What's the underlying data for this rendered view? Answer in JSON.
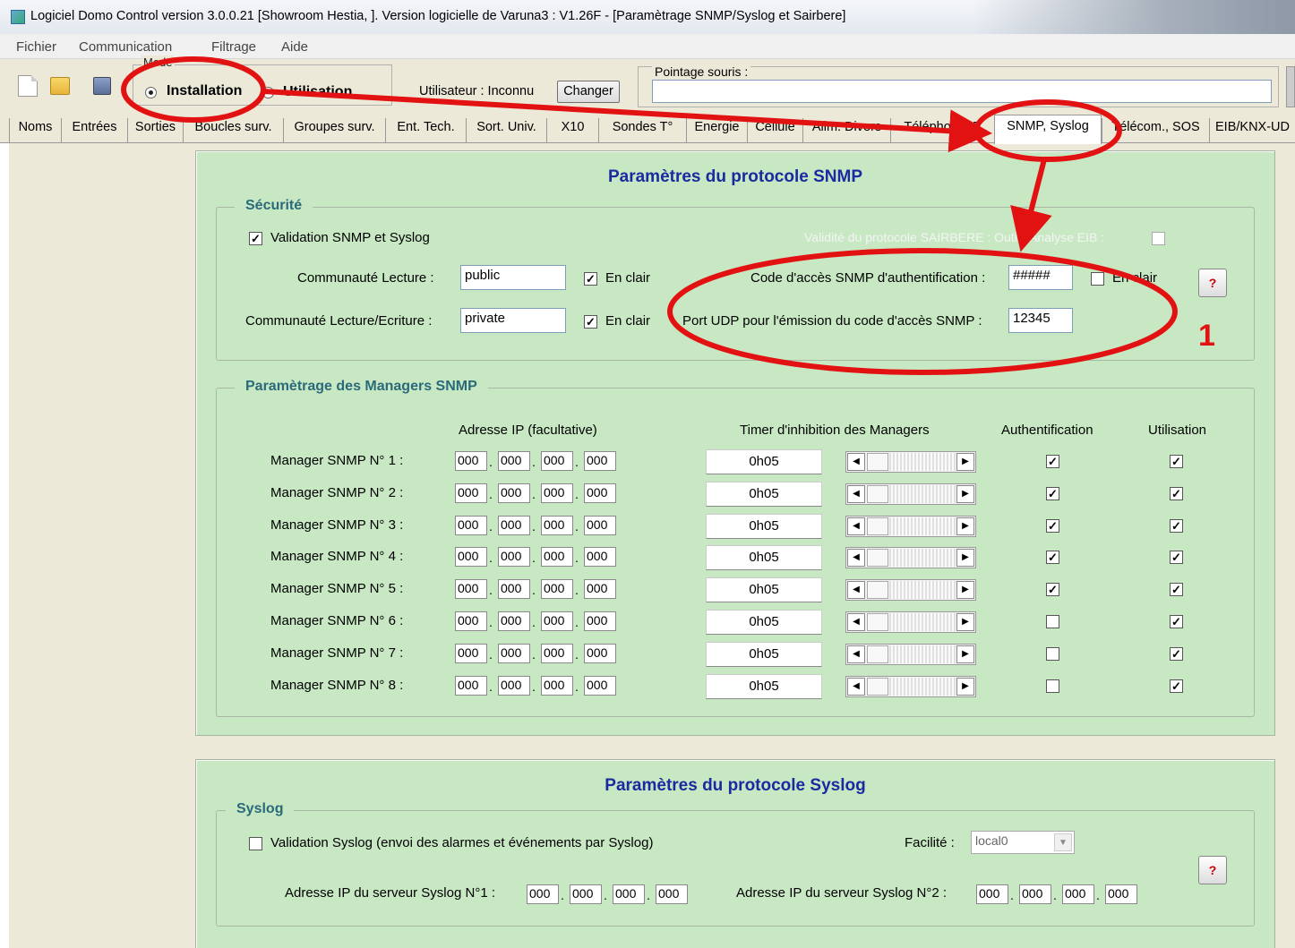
{
  "window": {
    "title": "Logiciel Domo Control version 3.0.0.21 [Showroom Hestia, ].   Version logicielle de Varuna3 : V1.26F - [Paramètrage SNMP/Syslog et Sairbere]"
  },
  "menubar": {
    "items": [
      "Fichier",
      "Communication",
      "Filtrage",
      "Aide"
    ]
  },
  "toolbar": {
    "mode_legend": "Mode",
    "mode_installation": "Installation",
    "mode_utilisation": "Utilisation",
    "selected_mode": "Installation",
    "user_label": "Utilisateur : Inconnu",
    "change_button": "Changer",
    "pointage_label": "Pointage souris :",
    "pointage_value": ""
  },
  "tabs": [
    "Noms",
    "Entrées",
    "Sorties",
    "Boucles surv.",
    "Groupes surv.",
    "Ent. Tech.",
    "Sort. Univ.",
    "X10",
    "Sondes T°",
    "Energie",
    "Cellule",
    "Alim. Divers",
    "Téléphone IP",
    "SNMP, Syslog",
    "Télécom., SOS",
    "EIB/KNX-UD"
  ],
  "active_tab": "SNMP, Syslog",
  "snmp": {
    "title": "Paramètres du protocole SNMP",
    "security": {
      "legend": "Sécurité",
      "validation_label": "Validation SNMP et Syslog",
      "validation_checked": true,
      "sairbere_label": "Validité du protocole SAIRBERE : Outils Analyse EIB :",
      "sairbere_checked": false,
      "read_community_label": "Communauté Lecture :",
      "read_community_value": "public",
      "read_clear_label": "En clair",
      "read_clear_checked": true,
      "rw_community_label": "Communauté Lecture/Ecriture :",
      "rw_community_value": "private",
      "rw_clear_label": "En clair",
      "rw_clear_checked": true,
      "auth_code_label": "Code d'accès SNMP d'authentification :",
      "auth_code_value": "#####",
      "auth_clear_label": "En clair",
      "auth_clear_checked": false,
      "udp_port_label": "Port UDP pour l'émission  du code d'accès SNMP :",
      "udp_port_value": "12345",
      "help": "?"
    },
    "managers": {
      "legend": "Paramètrage des Managers SNMP",
      "col_ip": "Adresse IP (facultative)",
      "col_timer": "Timer d'inhibition des Managers",
      "col_auth": "Authentification",
      "col_use": "Utilisation",
      "rows": [
        {
          "label": "Manager SNMP N° 1 :",
          "ip": [
            "000",
            "000",
            "000",
            "000"
          ],
          "timer": "0h05",
          "auth": true,
          "use": true
        },
        {
          "label": "Manager SNMP N° 2 :",
          "ip": [
            "000",
            "000",
            "000",
            "000"
          ],
          "timer": "0h05",
          "auth": true,
          "use": true
        },
        {
          "label": "Manager SNMP N° 3 :",
          "ip": [
            "000",
            "000",
            "000",
            "000"
          ],
          "timer": "0h05",
          "auth": true,
          "use": true
        },
        {
          "label": "Manager SNMP N° 4 :",
          "ip": [
            "000",
            "000",
            "000",
            "000"
          ],
          "timer": "0h05",
          "auth": true,
          "use": true
        },
        {
          "label": "Manager SNMP N° 5 :",
          "ip": [
            "000",
            "000",
            "000",
            "000"
          ],
          "timer": "0h05",
          "auth": true,
          "use": true
        },
        {
          "label": "Manager SNMP N° 6 :",
          "ip": [
            "000",
            "000",
            "000",
            "000"
          ],
          "timer": "0h05",
          "auth": false,
          "use": true
        },
        {
          "label": "Manager SNMP N° 7 :",
          "ip": [
            "000",
            "000",
            "000",
            "000"
          ],
          "timer": "0h05",
          "auth": false,
          "use": true
        },
        {
          "label": "Manager SNMP N° 8 :",
          "ip": [
            "000",
            "000",
            "000",
            "000"
          ],
          "timer": "0h05",
          "auth": false,
          "use": true
        }
      ]
    }
  },
  "syslog": {
    "title": "Paramètres du protocole Syslog",
    "legend": "Syslog",
    "validation_label": "Validation Syslog (envoi des alarmes et événements par Syslog)",
    "validation_checked": false,
    "facility_label": "Facilité :",
    "facility_value": "local0",
    "server1_label": "Adresse IP du serveur Syslog  N°1 :",
    "server1_ip": [
      "000",
      "000",
      "000",
      "000"
    ],
    "server2_label": "Adresse IP du serveur Syslog  N°2 :",
    "server2_ip": [
      "000",
      "000",
      "000",
      "000"
    ],
    "help": "?"
  },
  "annotation": {
    "number": "1",
    "color": "#e31212"
  }
}
